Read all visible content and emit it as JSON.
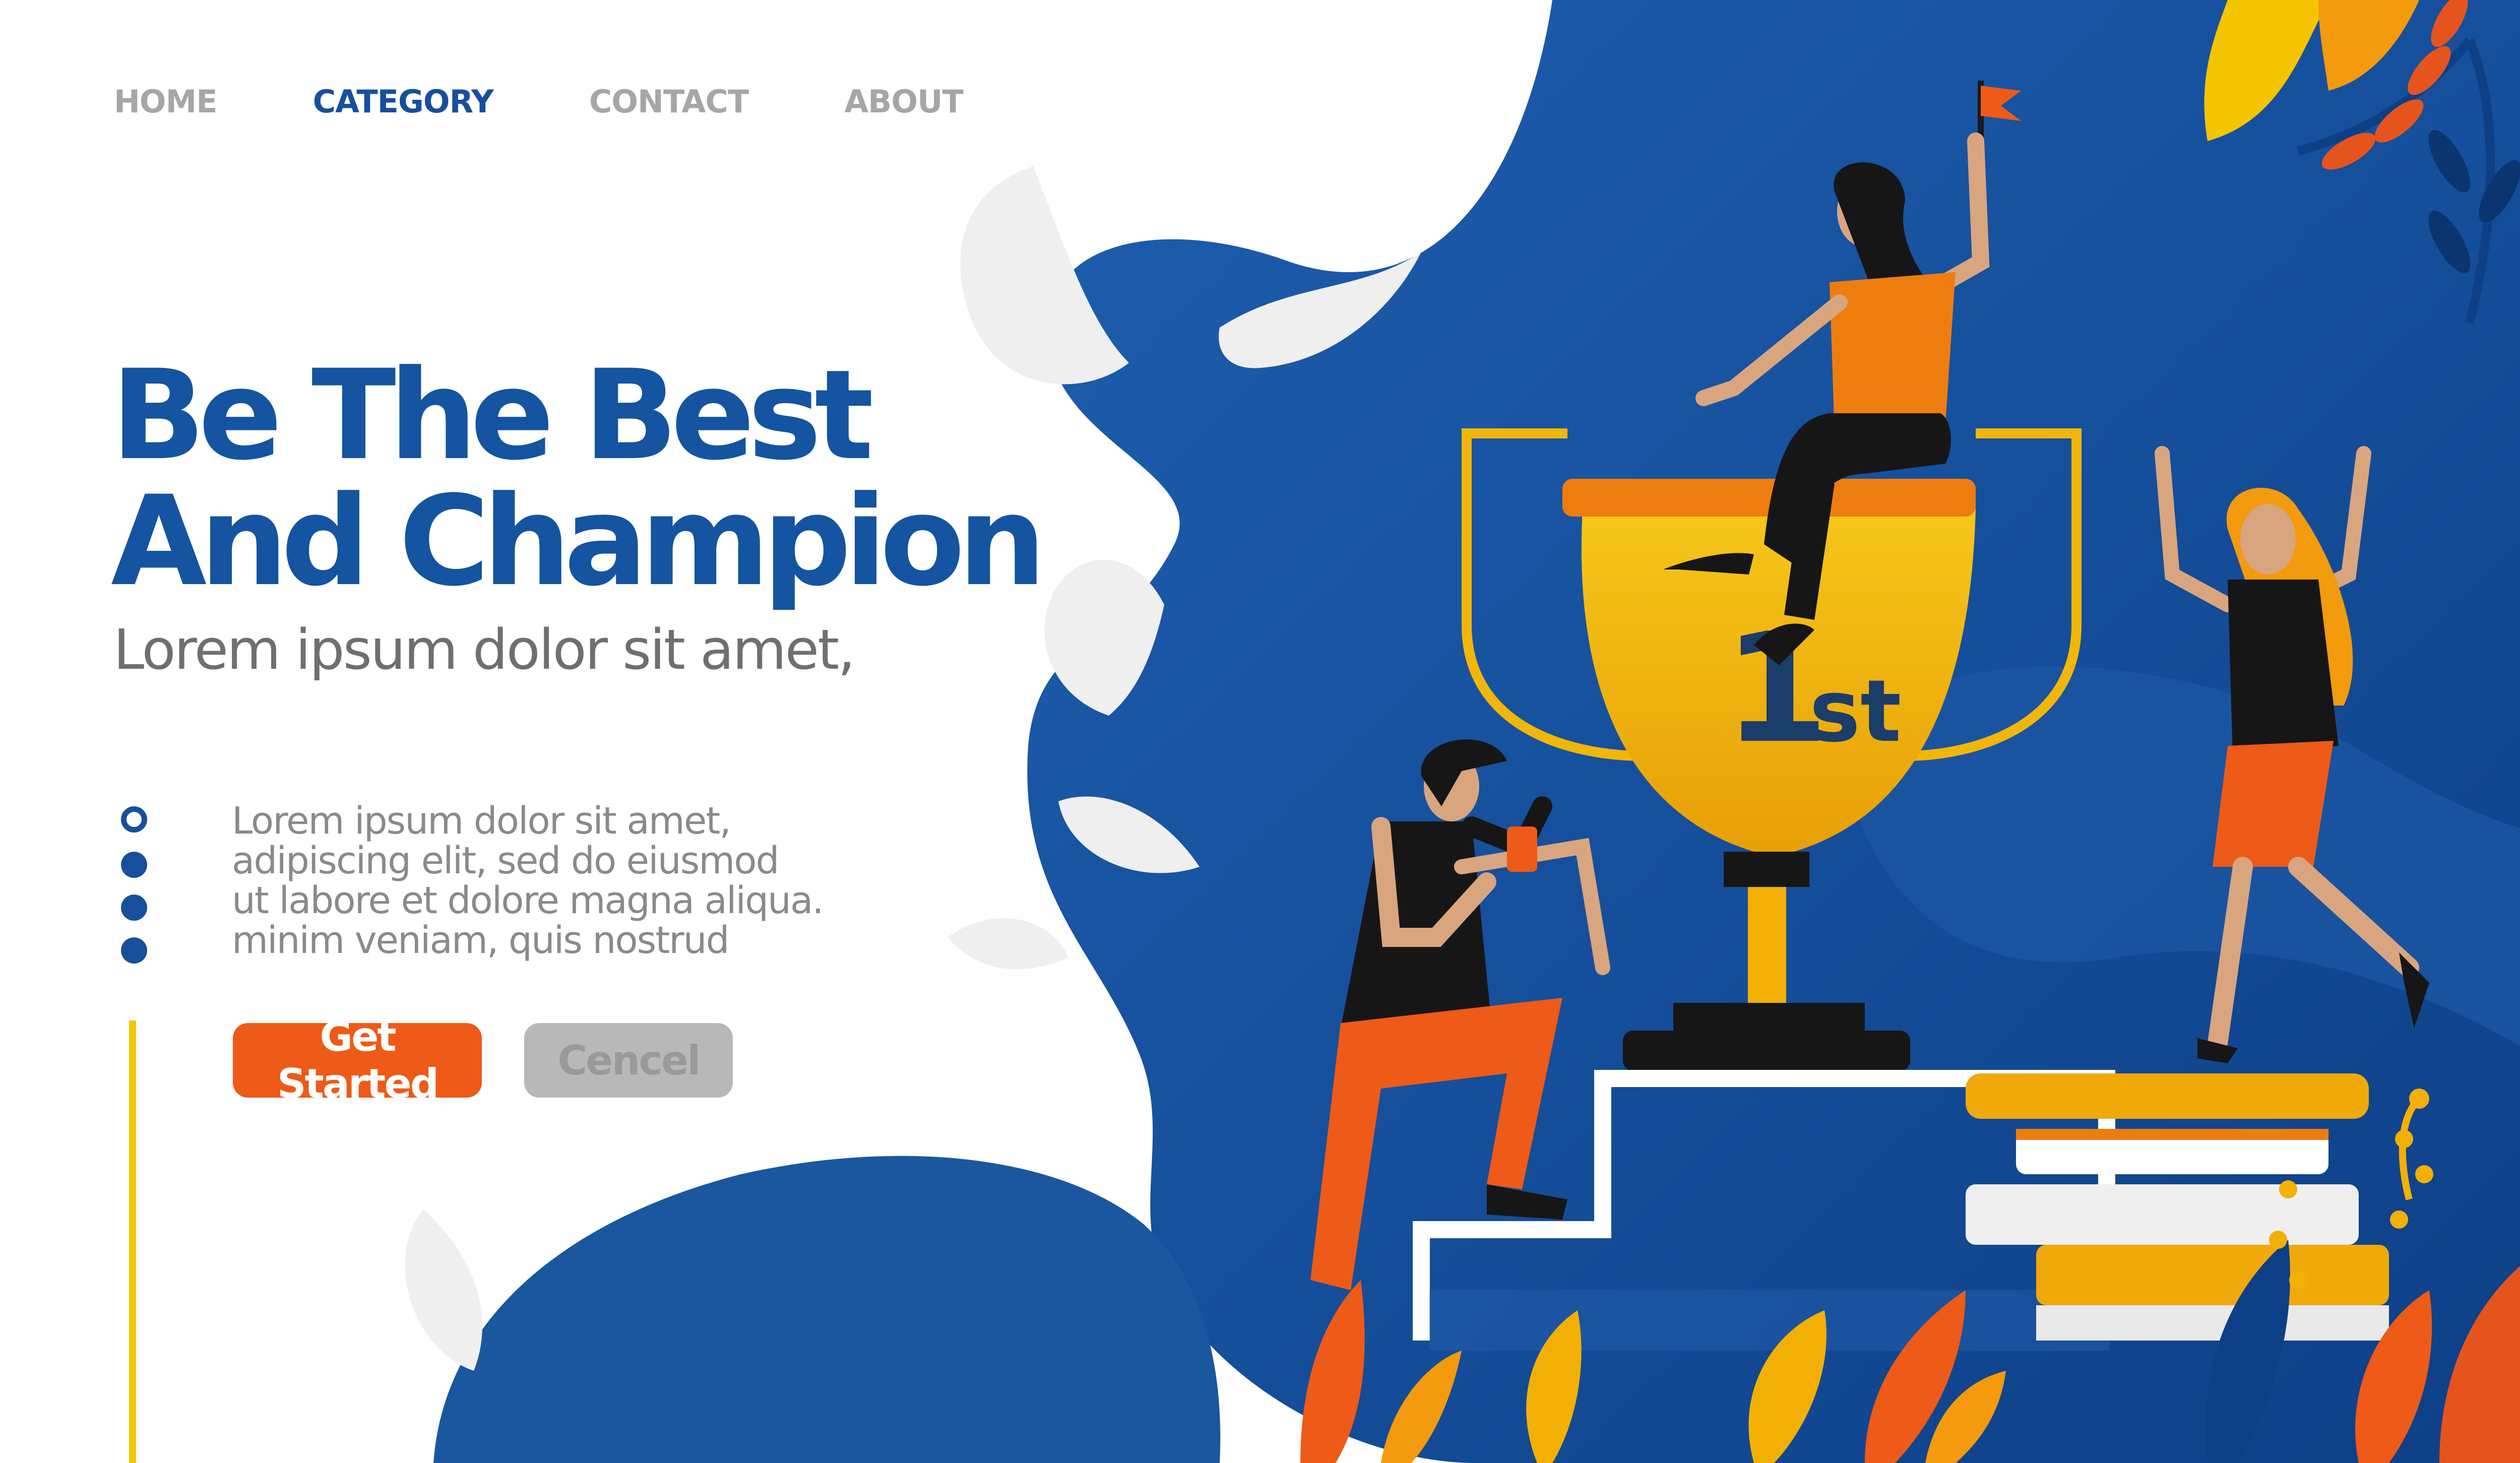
{
  "nav": {
    "items": [
      {
        "label": "HOME",
        "active": false
      },
      {
        "label": "CATEGORY",
        "active": true
      },
      {
        "label": "CONTACT",
        "active": false
      },
      {
        "label": "ABOUT",
        "active": false
      }
    ]
  },
  "hero": {
    "title_line1": "Be The Best",
    "title_line2": "And Champion",
    "subtitle": "Lorem ipsum dolor sit amet,",
    "paragraph_lines": [
      "Lorem ipsum dolor sit amet,",
      "adipiscing elit, sed do eiusmod",
      "ut labore et dolore magna aliqua.",
      "minim veniam, quis nostrud"
    ],
    "primary_button": "Get Started",
    "secondary_button": "Cencel"
  },
  "illustration": {
    "trophy_label_main": "1",
    "trophy_label_suffix": "st",
    "icons": [
      "trophy-icon",
      "flag-icon",
      "podium",
      "books-stack",
      "person-on-trophy",
      "person-cheering",
      "person-climbing"
    ]
  },
  "colors": {
    "brand_blue": "#174f9c",
    "accent_orange": "#ee5a17",
    "trophy_gold": "#f2b005",
    "button_grey": "#b8b8b8",
    "accent_yellow": "#f5c400"
  }
}
